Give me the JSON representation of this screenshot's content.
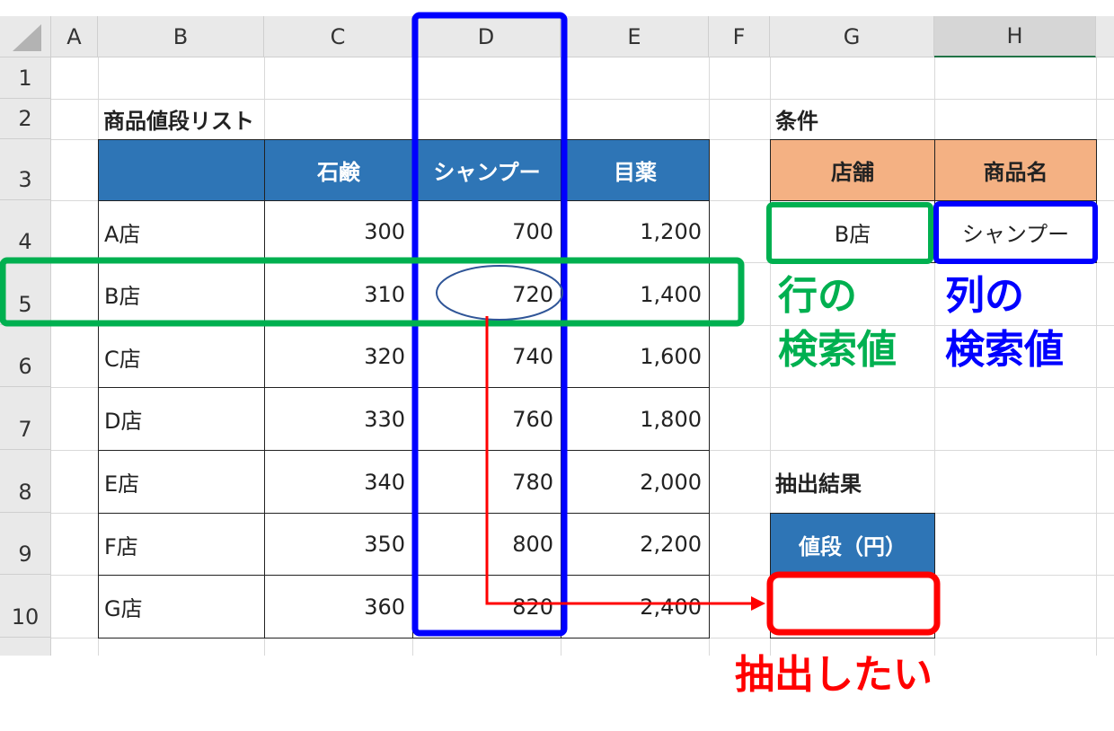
{
  "columns": [
    "A",
    "B",
    "C",
    "D",
    "E",
    "F",
    "G",
    "H"
  ],
  "rows": [
    "1",
    "2",
    "3",
    "4",
    "5",
    "6",
    "7",
    "8",
    "9",
    "10"
  ],
  "price_list": {
    "title": "商品値段リスト",
    "headers": [
      "",
      "石鹸",
      "シャンプー",
      "目薬"
    ],
    "rows": [
      {
        "store": "A店",
        "soap": "300",
        "shampoo": "700",
        "eyedrops": "1,200"
      },
      {
        "store": "B店",
        "soap": "310",
        "shampoo": "720",
        "eyedrops": "1,400"
      },
      {
        "store": "C店",
        "soap": "320",
        "shampoo": "740",
        "eyedrops": "1,600"
      },
      {
        "store": "D店",
        "soap": "330",
        "shampoo": "760",
        "eyedrops": "1,800"
      },
      {
        "store": "E店",
        "soap": "340",
        "shampoo": "780",
        "eyedrops": "2,000"
      },
      {
        "store": "F店",
        "soap": "350",
        "shampoo": "800",
        "eyedrops": "2,200"
      },
      {
        "store": "G店",
        "soap": "360",
        "shampoo": "820",
        "eyedrops": "2,400"
      }
    ]
  },
  "conditions": {
    "title": "条件",
    "store_header": "店舗",
    "product_header": "商品名",
    "store_value": "B店",
    "product_value": "シャンプー"
  },
  "result": {
    "title": "抽出結果",
    "header": "値段（円）",
    "value": ""
  },
  "annotations": {
    "row_lookup_line1": "行の",
    "row_lookup_line2": "検索値",
    "col_lookup_line1": "列の",
    "col_lookup_line2": "検索値",
    "extract": "抽出したい"
  },
  "colors": {
    "row_highlight": "#00b050",
    "col_highlight": "#0000ff",
    "target": "#ff0000",
    "header_blue": "#2e75b6",
    "header_orange": "#f4b183"
  }
}
